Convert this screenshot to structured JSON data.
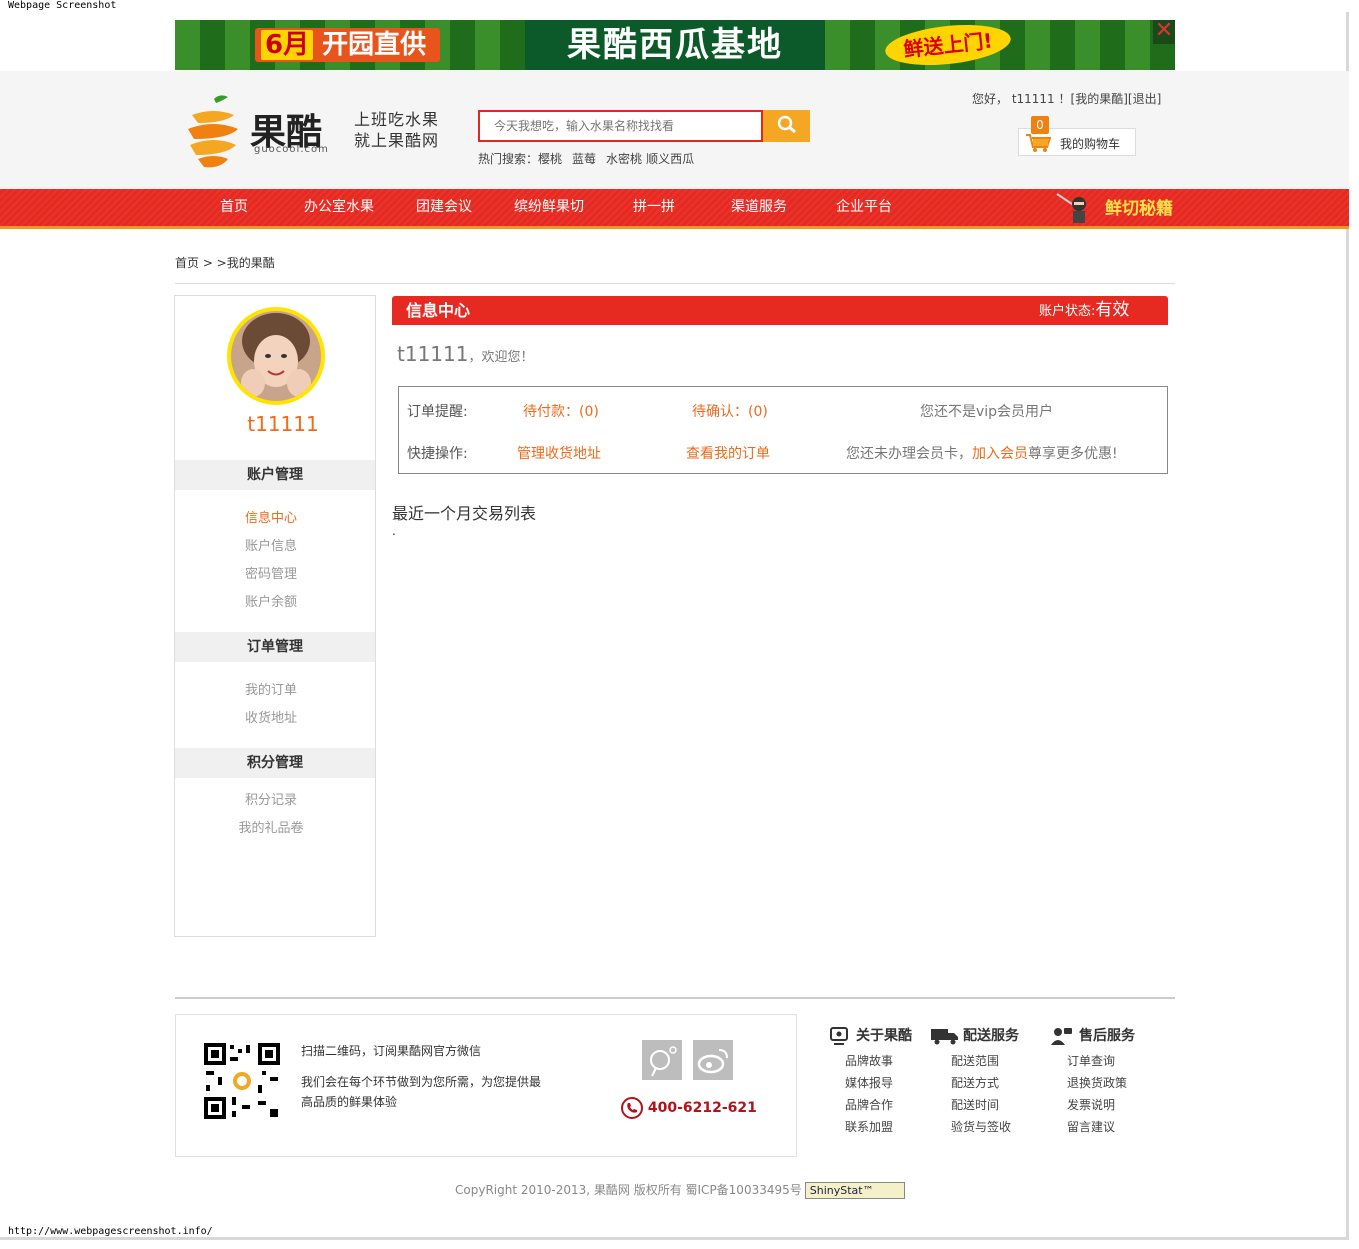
{
  "screenshot": {
    "label": "Webpage Screenshot",
    "url": "http://www.webpagescreenshot.info/"
  },
  "banner": {
    "part1_month": "6月",
    "part1_text": "开园直供",
    "title": "果酷西瓜基地",
    "badge": "鲜送上门!",
    "close": "✕"
  },
  "header": {
    "logo_name": "果酷",
    "logo_domain": "guocool.com",
    "slogan_line1": "上班吃水果",
    "slogan_line2": "就上果酷网",
    "search_placeholder": "今天我想吃，输入水果名称找找看",
    "hot_label": "热门搜索：",
    "hot_keywords": [
      "樱桃",
      "蓝莓",
      "水密桃",
      "顺义西瓜"
    ],
    "user_greeting": "您好， t11111 ！",
    "my_guocool": "[我的果酷]",
    "logout": "[退出]",
    "cart_count": "0",
    "cart_label": "我的购物车"
  },
  "nav": {
    "items": [
      "首页",
      "办公室水果",
      "团建会议",
      "缤纷鲜果切",
      "拼一拼",
      "渠道服务",
      "企业平台"
    ],
    "special": "鲜切秘籍"
  },
  "breadcrumb": "首页 > >我的果酷",
  "sidebar": {
    "username": "t11111",
    "sections": [
      {
        "title": "账户管理",
        "links": [
          "信息中心",
          "账户信息",
          "密码管理",
          "账户余额"
        ]
      },
      {
        "title": "订单管理",
        "links": [
          "我的订单",
          "收货地址"
        ]
      },
      {
        "title": "积分管理",
        "links": [
          "积分记录",
          "我的礼品卷"
        ]
      }
    ]
  },
  "main": {
    "title": "信息中心",
    "status_label": "账户状态:",
    "status_value": "有效",
    "welcome_user": "t11111",
    "welcome_text": "，欢迎您！",
    "order_reminder_label": "订单提醒:",
    "pending_payment": "待付款：(0)",
    "pending_confirm": "待确认：(0)",
    "vip_status": "您还不是vip会员用户",
    "quick_ops_label": "快捷操作:",
    "manage_address": "管理收货地址",
    "view_orders": "查看我的订单",
    "member_text_a": "您还未办理会员卡，",
    "join_member": "加入会员",
    "member_text_b": "尊享更多优惠!",
    "recent_title": "最近一个月交易列表",
    "recent_placeholder": "."
  },
  "footer": {
    "qr_text": "扫描二维码，订阅果酷网官方微信",
    "promise_text": "我们会在每个环节做到为您所需，为您提供最高品质的鲜果体验",
    "phone": "400-6212-621",
    "columns": [
      {
        "title": "关于果酷",
        "links": [
          "品牌故事",
          "媒体报导",
          "品牌合作",
          "联系加盟"
        ]
      },
      {
        "title": "配送服务",
        "links": [
          "配送范围",
          "配送方式",
          "配送时间",
          "验货与签收"
        ]
      },
      {
        "title": "售后服务",
        "links": [
          "订单查询",
          "退换货政策",
          "发票说明",
          "留言建议"
        ]
      }
    ],
    "copyright": "CopyRight 2010-2013, 果酷网 版权所有 蜀ICP备10033495号",
    "stat_badge": "ShinyStat™"
  },
  "colors": {
    "brand_red": "#e62a22",
    "accent_orange": "#f06a1c",
    "nav_border": "#f5961e",
    "banner_green": "#3b8f2b"
  }
}
